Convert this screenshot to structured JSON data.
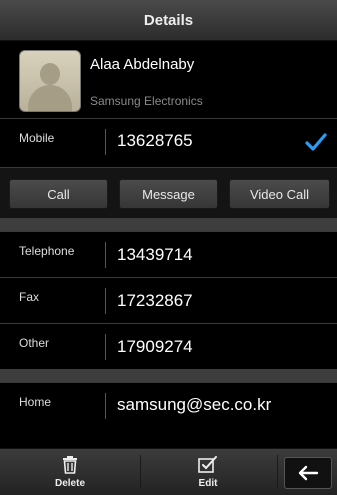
{
  "title": "Details",
  "contact": {
    "name": "Alaa Abdelnaby",
    "company": "Samsung Electronics"
  },
  "mobile": {
    "label": "Mobile",
    "value": "13628765",
    "check_icon": "checkmark-icon",
    "check_color": "#2a9df4"
  },
  "actions": {
    "call": "Call",
    "message": "Message",
    "video_call": "Video Call"
  },
  "phones": [
    {
      "label": "Telephone",
      "value": "13439714"
    },
    {
      "label": "Fax",
      "value": "17232867"
    },
    {
      "label": "Other",
      "value": "17909274"
    }
  ],
  "email": {
    "label": "Home",
    "value": "samsung@sec.co.kr"
  },
  "toolbar": {
    "delete_label": "Delete",
    "delete_icon": "trash-icon",
    "edit_label": "Edit",
    "edit_icon": "edit-checkbox-icon",
    "back_icon": "back-arrow-icon"
  }
}
